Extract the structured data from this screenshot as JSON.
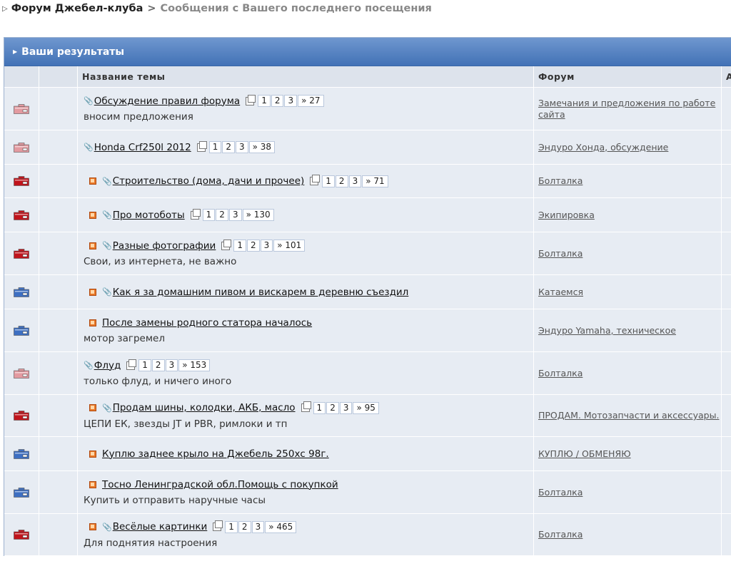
{
  "breadcrumb": {
    "home": "Форум Джебел-клуба",
    "separator": ">",
    "current": "Сообщения с Вашего последнего посещения"
  },
  "panel": {
    "title": "Ваши результаты"
  },
  "table": {
    "headers": {
      "topic": "Название темы",
      "forum": "Форум",
      "extra": "А"
    },
    "rows": [
      {
        "icon": "folder-pink",
        "new": false,
        "attach": true,
        "title": "Обсуждение правил форума",
        "pages": [
          "1",
          "2",
          "3",
          "» 27"
        ],
        "subtitle": "вносим предложения",
        "forum": "Замечания и предложения по работе сайта"
      },
      {
        "icon": "folder-pink",
        "new": false,
        "attach": true,
        "title": "Honda Crf250l 2012",
        "pages": [
          "1",
          "2",
          "3",
          "» 38"
        ],
        "subtitle": "",
        "forum": "Эндуро Хонда, обсуждение"
      },
      {
        "icon": "folder-red",
        "new": true,
        "attach": true,
        "title": "Строительство (дома, дачи и прочее)",
        "pages": [
          "1",
          "2",
          "3",
          "» 71"
        ],
        "subtitle": "",
        "forum": "Болталка"
      },
      {
        "icon": "folder-red",
        "new": true,
        "attach": true,
        "title": "Про мотоботы",
        "pages": [
          "1",
          "2",
          "3",
          "» 130"
        ],
        "subtitle": "",
        "forum": "Экипировка"
      },
      {
        "icon": "folder-red",
        "new": true,
        "attach": true,
        "title": "Разные фотографии",
        "pages": [
          "1",
          "2",
          "3",
          "» 101"
        ],
        "subtitle": "Свои, из интернета, не важно",
        "forum": "Болталка"
      },
      {
        "icon": "folder-blue",
        "new": true,
        "attach": true,
        "title": "Как я за домашним пивом и вискарем в деревню съездил",
        "pages": [],
        "subtitle": "",
        "forum": "Катаемся"
      },
      {
        "icon": "folder-blue",
        "new": true,
        "attach": false,
        "title": "После замены родного статора началось",
        "pages": [],
        "subtitle": "мотор загремел",
        "forum": "Эндуро Yamaha, техническое"
      },
      {
        "icon": "folder-pink",
        "new": false,
        "attach": true,
        "title": "Флуд",
        "pages": [
          "1",
          "2",
          "3",
          "» 153"
        ],
        "subtitle": "только флуд, и ничего иного",
        "forum": "Болталка"
      },
      {
        "icon": "folder-red",
        "new": true,
        "attach": true,
        "title": "Продам шины, колодки, АКБ, масло",
        "pages": [
          "1",
          "2",
          "3",
          "» 95"
        ],
        "subtitle": "ЦЕПИ ЕК, звезды JT и PBR, римлоки и тп",
        "forum": "ПРОДАМ. Мотозапчасти и аксессуары."
      },
      {
        "icon": "folder-blue",
        "new": true,
        "attach": false,
        "title": "Куплю заднее крыло на Джебель 250хс 98г.",
        "pages": [],
        "subtitle": "",
        "forum": "КУПЛЮ / ОБМЕНЯЮ"
      },
      {
        "icon": "folder-blue",
        "new": true,
        "attach": false,
        "title": "Тосно Ленинградской обл.Помощь с покупкой",
        "pages": [],
        "subtitle": "Купить и отправить наручные часы",
        "forum": "Болталка"
      },
      {
        "icon": "folder-red",
        "new": true,
        "attach": true,
        "title": "Весёлые картинки",
        "pages": [
          "1",
          "2",
          "3",
          "» 465"
        ],
        "subtitle": "Для поднятия настроения",
        "forum": "Болталка"
      }
    ]
  },
  "colors": {
    "folder-pink": "#e39aa0",
    "folder-red": "#c0141c",
    "folder-blue": "#3d6fc2",
    "header-accent": "#4272b6"
  }
}
